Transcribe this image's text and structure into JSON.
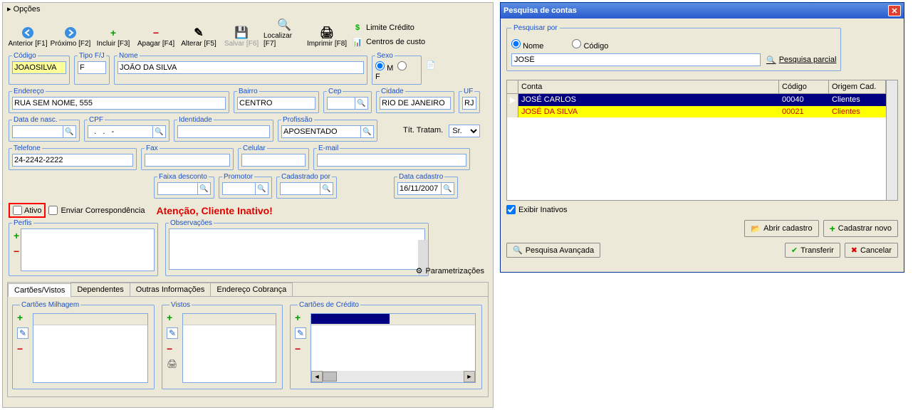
{
  "opcoes": "Opções",
  "toolbar": {
    "anterior": "Anterior [F1]",
    "proximo": "Próximo [F2]",
    "incluir": "Incluir [F3]",
    "apagar": "Apagar [F4]",
    "alterar": "Alterar [F5]",
    "salvar": "Salvar [F6]",
    "localizar": "Localizar [F7]",
    "imprimir": "Imprimir [F8]",
    "limite": "Limite Crédito",
    "centros": "Centros de custo"
  },
  "labels": {
    "codigo": "Código",
    "tipo": "Tipo F/J",
    "nome": "Nome",
    "sexo": "Sexo",
    "m": "M",
    "f": "F",
    "endereco": "Endereço",
    "bairro": "Bairro",
    "cep": "Cep",
    "cidade": "Cidade",
    "uf": "UF",
    "datanasc": "Data de nasc.",
    "cpf": "CPF",
    "identidade": "Identidade",
    "profissao": "Profissão",
    "tittratam": "Tít. Tratam.",
    "telefone": "Telefone",
    "fax": "Fax",
    "celular": "Celular",
    "email": "E-mail",
    "faixa": "Faixa desconto",
    "promotor": "Promotor",
    "cadpor": "Cadastrado por",
    "datacad": "Data cadastro",
    "ativo": "Ativo",
    "enviar": "Enviar Correspondência",
    "perfis": "Perfis",
    "obs": "Observações",
    "param": "Parametrizações",
    "tabCartoes": "Cartões/Vistos",
    "tabDep": "Dependentes",
    "tabOutras": "Outras Informações",
    "tabEnd": "Endereço Cobrança",
    "milhagem": "Cartões Milhagem",
    "vistos": "Vistos",
    "credito": "Cartões de Crédito"
  },
  "values": {
    "codigo": "JOAOSILVA",
    "tipo": "F",
    "nome": "JOÃO DA SILVA",
    "endereco": "RUA SEM NOME, 555",
    "bairro": "CENTRO",
    "cep": "",
    "cidade": "RIO DE JANEIRO",
    "uf": "RJ",
    "datanasc": "",
    "cpf": "  .   .   -",
    "identidade": "",
    "profissao": "APOSENTADO",
    "tittratam": "Sr.",
    "telefone": "24-2242-2222",
    "fax": "",
    "celular": "",
    "email": "",
    "datacad": "16/11/2007"
  },
  "atencao": "Atenção, Cliente Inativo!",
  "dialog": {
    "title": "Pesquisa de contas",
    "pesquisar": "Pesquisar por",
    "rNome": "Nome",
    "rCodigo": "Código",
    "input": "JOSÉ",
    "parcial": "Pesquisa parcial",
    "cols": {
      "conta": "Conta",
      "codigo": "Código",
      "origem": "Origem Cad."
    },
    "rows": [
      {
        "conta": "JOSÉ CARLOS",
        "codigo": "00040",
        "origem": "Clientes",
        "class": "r-blue",
        "sel": "▶"
      },
      {
        "conta": "JOSÉ DA SILVA",
        "codigo": "00021",
        "origem": "Clientes",
        "class": "r-yellow",
        "sel": ""
      }
    ],
    "exibir": "Exibir Inativos",
    "abrir": "Abrir cadastro",
    "cadnovo": "Cadastrar novo",
    "avanc": "Pesquisa Avançada",
    "transf": "Transferir",
    "cancel": "Cancelar"
  }
}
